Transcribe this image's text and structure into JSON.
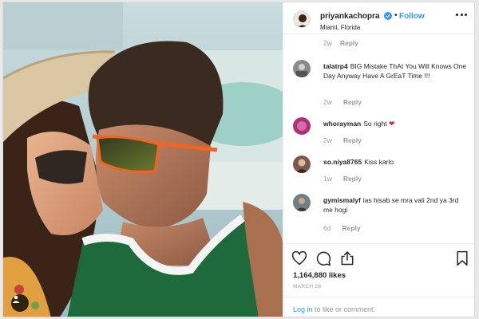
{
  "post": {
    "username": "priyankachopra",
    "follow_label": "Follow",
    "location": "Miami, Florida",
    "dot": "•"
  },
  "top_meta": {
    "time": "2w",
    "reply": "Reply"
  },
  "comments": [
    {
      "user": "talatrp4",
      "text": "BIG Mistake ThAt You Will Knows One Day Anyway Have A GrEaT Time !!!",
      "time": "2w",
      "reply": "Reply",
      "avatar_color": "#8a8a8a"
    },
    {
      "user": "whorayman",
      "text": "So right",
      "heart": "❤",
      "time": "2w",
      "reply": "Reply",
      "avatar_color": "#b0307a"
    },
    {
      "user": "so.niya8765",
      "text": "Kiss karlo",
      "time": "1w",
      "reply": "Reply",
      "avatar_color": "#7b5a4a"
    },
    {
      "user": "gymismalyf",
      "text": "las hisab se mra vali 2nd ya 3rd me hogi",
      "time": "6d",
      "reply": "Reply",
      "avatar_color": "#6e7f86"
    }
  ],
  "actions": {
    "likes": "1,164,880 likes",
    "date": "MARCH 26",
    "login_link": "Log in",
    "login_rest": " to like or comment."
  },
  "icons": [
    "user-tag-icon",
    "verified-badge-icon",
    "more-options-icon",
    "heart-icon",
    "comment-icon",
    "share-icon",
    "bookmark-icon"
  ],
  "colors": {
    "accent": "#3897f0",
    "heart": "#ed4956",
    "muted": "#999999",
    "text": "#262626"
  }
}
